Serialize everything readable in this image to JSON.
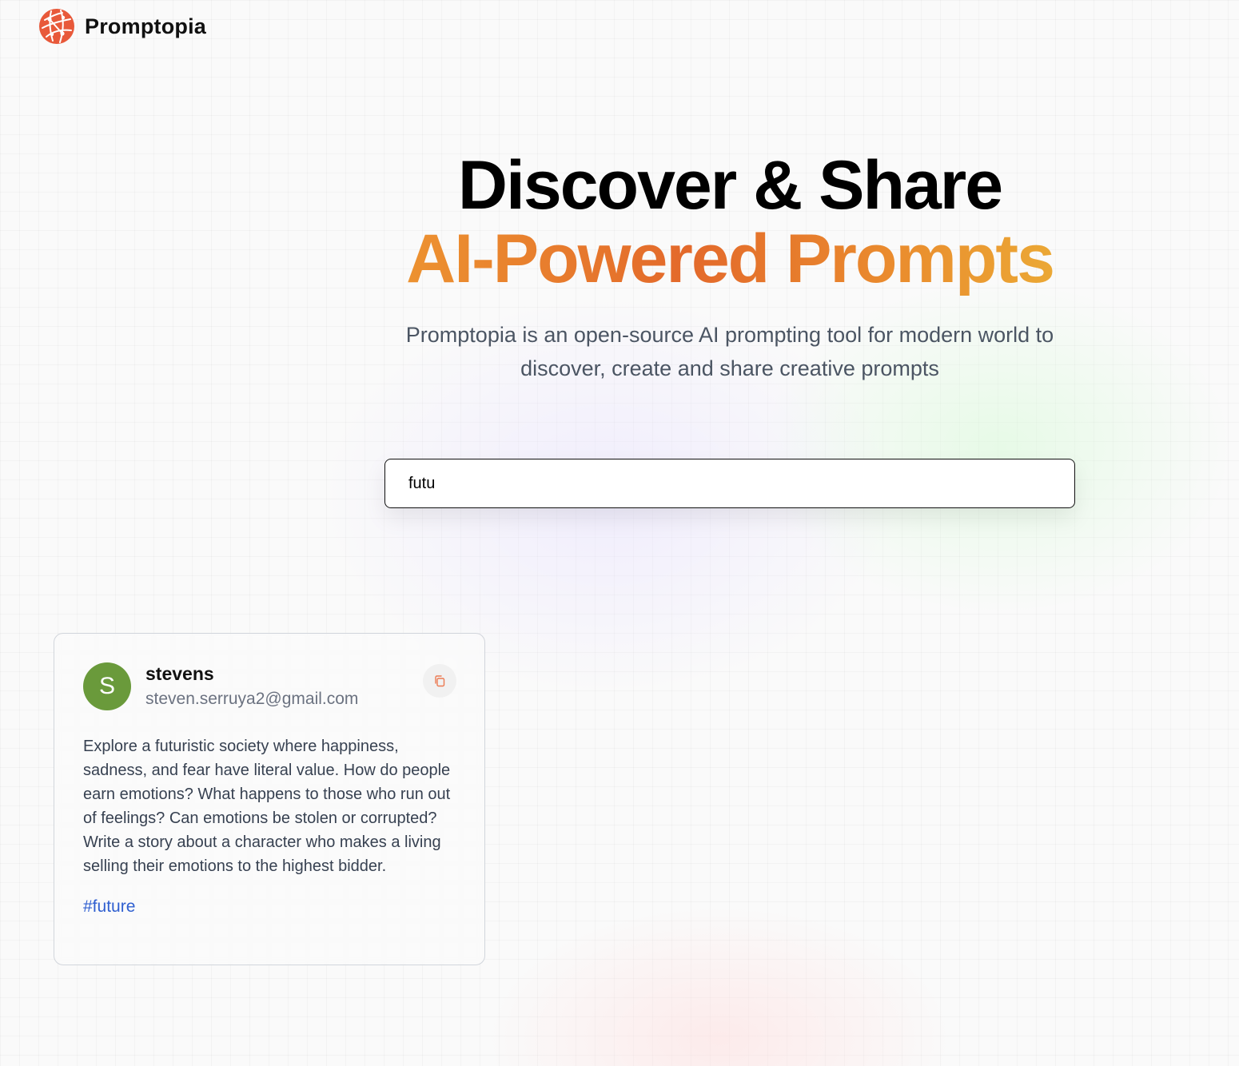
{
  "nav": {
    "brand": "Promptopia",
    "logo_icon": "globe-network-icon"
  },
  "hero": {
    "title_line1": "Discover & Share",
    "title_line2": "AI-Powered Prompts",
    "description": "Promptopia is an open-source AI prompting tool for modern world to discover, create and share creative prompts"
  },
  "search": {
    "value": "futu"
  },
  "prompts": [
    {
      "avatar_letter": "S",
      "avatar_color": "#6a9a3b",
      "username": "stevens",
      "email": "steven.serruya2@gmail.com",
      "text": "Explore a futuristic society where happiness, sadness, and fear have literal value. How do people earn emotions? What happens to those who run out of feelings? Can emotions be stolen or corrupted? Write a story about a character who makes a living selling their emotions to the highest bidder.",
      "tag": "#future",
      "copy_icon": "copy-icon"
    }
  ],
  "colors": {
    "accent_orange": "#e3692b",
    "tag_blue": "#2f5fd0"
  }
}
